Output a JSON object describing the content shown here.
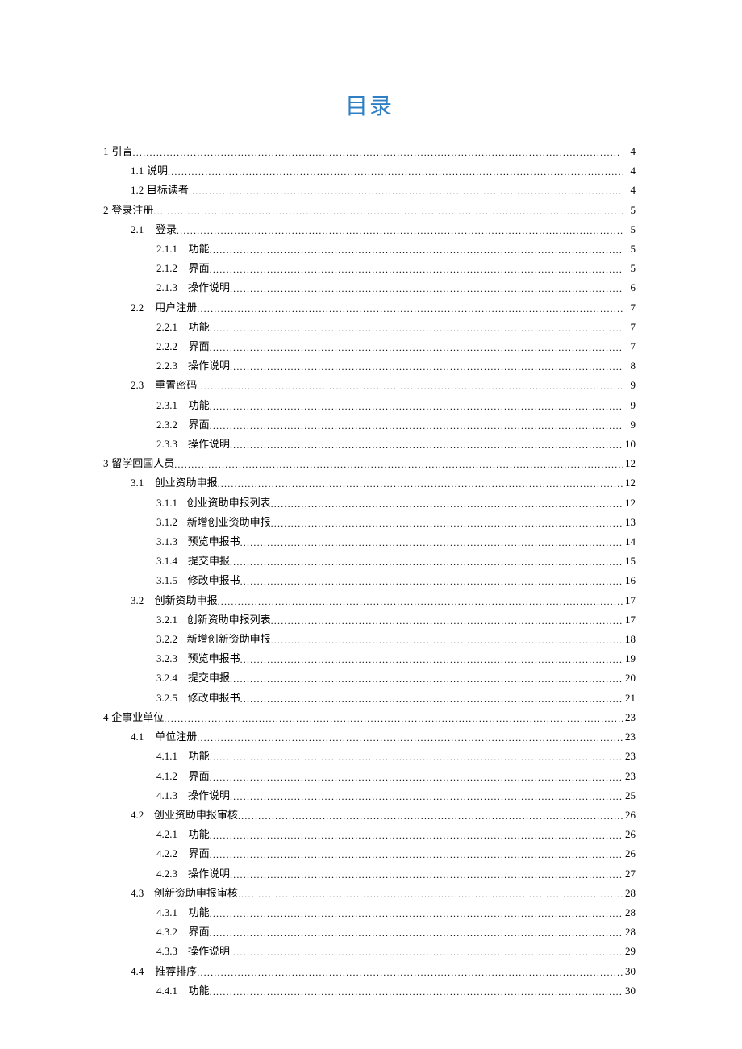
{
  "title": "目录",
  "toc": [
    {
      "level": 0,
      "num": "1",
      "gap": "sm",
      "label": "引言",
      "page": "4"
    },
    {
      "level": 1,
      "num": "1.1",
      "gap": "sm",
      "label": "说明",
      "page": "4"
    },
    {
      "level": 1,
      "num": "1.2",
      "gap": "sm",
      "label": "目标读者",
      "page": "4"
    },
    {
      "level": 0,
      "num": "2",
      "gap": "sm",
      "label": "登录注册",
      "page": "5"
    },
    {
      "level": 1,
      "num": "2.1",
      "gap": "md",
      "label": "登录",
      "page": "5"
    },
    {
      "level": 2,
      "num": "2.1.1",
      "gap": "md",
      "label": "功能",
      "page": "5"
    },
    {
      "level": 2,
      "num": "2.1.2",
      "gap": "md",
      "label": "界面",
      "page": "5"
    },
    {
      "level": 2,
      "num": "2.1.3",
      "gap": "md",
      "label": "操作说明",
      "page": "6"
    },
    {
      "level": 1,
      "num": "2.2",
      "gap": "md",
      "label": "用户注册",
      "page": "7"
    },
    {
      "level": 2,
      "num": "2.2.1",
      "gap": "md",
      "label": "功能",
      "page": "7"
    },
    {
      "level": 2,
      "num": "2.2.2",
      "gap": "md",
      "label": "界面",
      "page": "7"
    },
    {
      "level": 2,
      "num": "2.2.3",
      "gap": "md",
      "label": "操作说明",
      "page": "8"
    },
    {
      "level": 1,
      "num": "2.3",
      "gap": "md",
      "label": "重置密码",
      "page": "9"
    },
    {
      "level": 2,
      "num": "2.3.1",
      "gap": "md",
      "label": "功能",
      "page": "9"
    },
    {
      "level": 2,
      "num": "2.3.2",
      "gap": "md",
      "label": "界面",
      "page": "9"
    },
    {
      "level": 2,
      "num": "2.3.3",
      "gap": "md",
      "label": "操作说明",
      "page": "10"
    },
    {
      "level": 0,
      "num": "3",
      "gap": "sm",
      "label": "留学回国人员",
      "page": "12"
    },
    {
      "level": 1,
      "num": "3.1",
      "gap": "md",
      "label": "创业资助申报",
      "page": "12"
    },
    {
      "level": 2,
      "num": "3.1.1",
      "gap": "md",
      "label": "创业资助申报列表",
      "page": "12"
    },
    {
      "level": 2,
      "num": "3.1.2",
      "gap": "md",
      "label": "新增创业资助申报",
      "page": "13"
    },
    {
      "level": 2,
      "num": "3.1.3",
      "gap": "md",
      "label": "预览申报书",
      "page": "14"
    },
    {
      "level": 2,
      "num": "3.1.4",
      "gap": "md",
      "label": "提交申报",
      "page": "15"
    },
    {
      "level": 2,
      "num": "3.1.5",
      "gap": "md",
      "label": "修改申报书",
      "page": "16"
    },
    {
      "level": 1,
      "num": "3.2",
      "gap": "md",
      "label": "创新资助申报",
      "page": "17"
    },
    {
      "level": 2,
      "num": "3.2.1",
      "gap": "md",
      "label": "创新资助申报列表",
      "page": "17"
    },
    {
      "level": 2,
      "num": "3.2.2",
      "gap": "md",
      "label": "新增创新资助申报",
      "page": "18"
    },
    {
      "level": 2,
      "num": "3.2.3",
      "gap": "md",
      "label": "预览申报书",
      "page": "19"
    },
    {
      "level": 2,
      "num": "3.2.4",
      "gap": "md",
      "label": "提交申报",
      "page": "20"
    },
    {
      "level": 2,
      "num": "3.2.5",
      "gap": "md",
      "label": "修改申报书",
      "page": "21"
    },
    {
      "level": 0,
      "num": "4",
      "gap": "sm",
      "label": "企事业单位",
      "page": "23"
    },
    {
      "level": 1,
      "num": "4.1",
      "gap": "md",
      "label": "单位注册",
      "page": "23"
    },
    {
      "level": 2,
      "num": "4.1.1",
      "gap": "md",
      "label": "功能",
      "page": "23"
    },
    {
      "level": 2,
      "num": "4.1.2",
      "gap": "md",
      "label": "界面",
      "page": "23"
    },
    {
      "level": 2,
      "num": "4.1.3",
      "gap": "md",
      "label": "操作说明",
      "page": "25"
    },
    {
      "level": 1,
      "num": "4.2",
      "gap": "md",
      "label": "创业资助申报审核",
      "page": "26"
    },
    {
      "level": 2,
      "num": "4.2.1",
      "gap": "md",
      "label": "功能",
      "page": "26"
    },
    {
      "level": 2,
      "num": "4.2.2",
      "gap": "md",
      "label": "界面",
      "page": "26"
    },
    {
      "level": 2,
      "num": "4.2.3",
      "gap": "md",
      "label": "操作说明",
      "page": "27"
    },
    {
      "level": 1,
      "num": "4.3",
      "gap": "md",
      "label": "创新资助申报审核",
      "page": "28"
    },
    {
      "level": 2,
      "num": "4.3.1",
      "gap": "md",
      "label": "功能",
      "page": "28"
    },
    {
      "level": 2,
      "num": "4.3.2",
      "gap": "md",
      "label": "界面",
      "page": "28"
    },
    {
      "level": 2,
      "num": "4.3.3",
      "gap": "md",
      "label": "操作说明",
      "page": "29"
    },
    {
      "level": 1,
      "num": "4.4",
      "gap": "md",
      "label": "推荐排序",
      "page": "30"
    },
    {
      "level": 2,
      "num": "4.4.1",
      "gap": "md",
      "label": "功能",
      "page": "30"
    }
  ]
}
